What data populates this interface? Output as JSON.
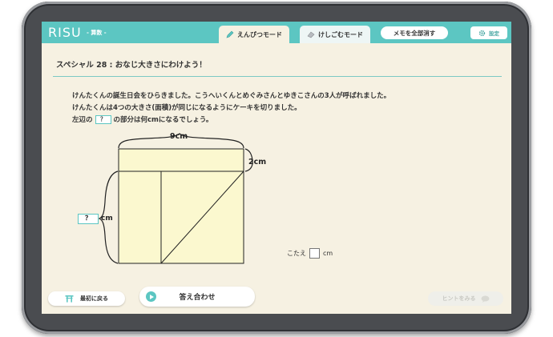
{
  "app": {
    "logo": "RISU",
    "subject": "- 算数 -"
  },
  "toolbar": {
    "pencil_mode": "えんぴつモード",
    "eraser_mode": "けしごむモード",
    "clear_memo": "メモを全部消す",
    "settings": "設定"
  },
  "problem": {
    "title": "スペシャル 28 : おなじ大きさにわけよう！",
    "line1": "けんたくんの誕生日会をひらきました。こうへいくんとめぐみさんとゆきこさんの3人が呼ばれました。",
    "line2": "けんたくんは4つの大きさ(面積)が同じになるようにケーキを切りました。",
    "line3_before": "左辺の",
    "line3_box": "？",
    "line3_after": "の部分は何cmになるでしょう。"
  },
  "figure": {
    "top_label": "9cm",
    "right_label": "2cm",
    "left_box": "？",
    "left_unit": "cm"
  },
  "answer": {
    "prefix": "こたえ",
    "unit": "cm"
  },
  "buttons": {
    "back": "最初に戻る",
    "check": "答え合わせ",
    "hint": "ヒントをみる"
  },
  "colors": {
    "accent": "#5cc6c2",
    "screen_bg": "#f6f1e2",
    "cake_fill": "#fbf8cf"
  }
}
